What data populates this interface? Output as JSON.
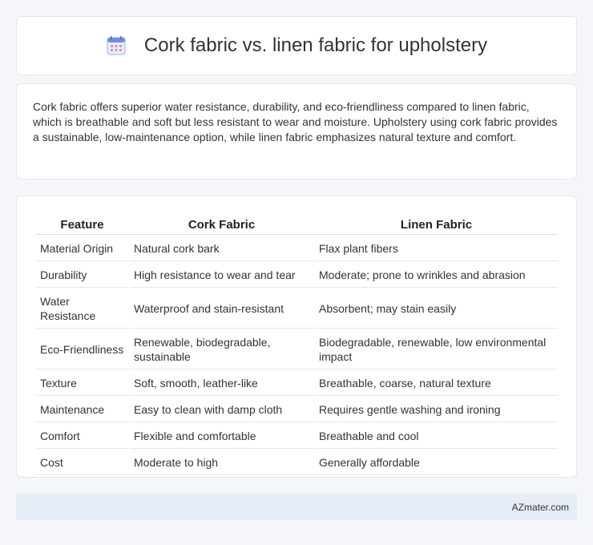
{
  "header": {
    "title": "Cork fabric vs. linen fabric for upholstery",
    "icon": "calendar-icon"
  },
  "summary": {
    "text": "Cork fabric offers superior water resistance, durability, and eco-friendliness compared to linen fabric, which is breathable and soft but less resistant to wear and moisture. Upholstery using cork fabric provides a sustainable, low-maintenance option, while linen fabric emphasizes natural texture and comfort."
  },
  "table": {
    "headers": [
      "Feature",
      "Cork Fabric",
      "Linen Fabric"
    ],
    "rows": [
      [
        "Material Origin",
        "Natural cork bark",
        "Flax plant fibers"
      ],
      [
        "Durability",
        "High resistance to wear and tear",
        "Moderate; prone to wrinkles and abrasion"
      ],
      [
        "Water Resistance",
        "Waterproof and stain-resistant",
        "Absorbent; may stain easily"
      ],
      [
        "Eco-Friendliness",
        "Renewable, biodegradable, sustainable",
        "Biodegradable, renewable, low environmental impact"
      ],
      [
        "Texture",
        "Soft, smooth, leather-like",
        "Breathable, coarse, natural texture"
      ],
      [
        "Maintenance",
        "Easy to clean with damp cloth",
        "Requires gentle washing and ironing"
      ],
      [
        "Comfort",
        "Flexible and comfortable",
        "Breathable and cool"
      ],
      [
        "Cost",
        "Moderate to high",
        "Generally affordable"
      ]
    ]
  },
  "footer": {
    "site": "AZmater.com"
  }
}
